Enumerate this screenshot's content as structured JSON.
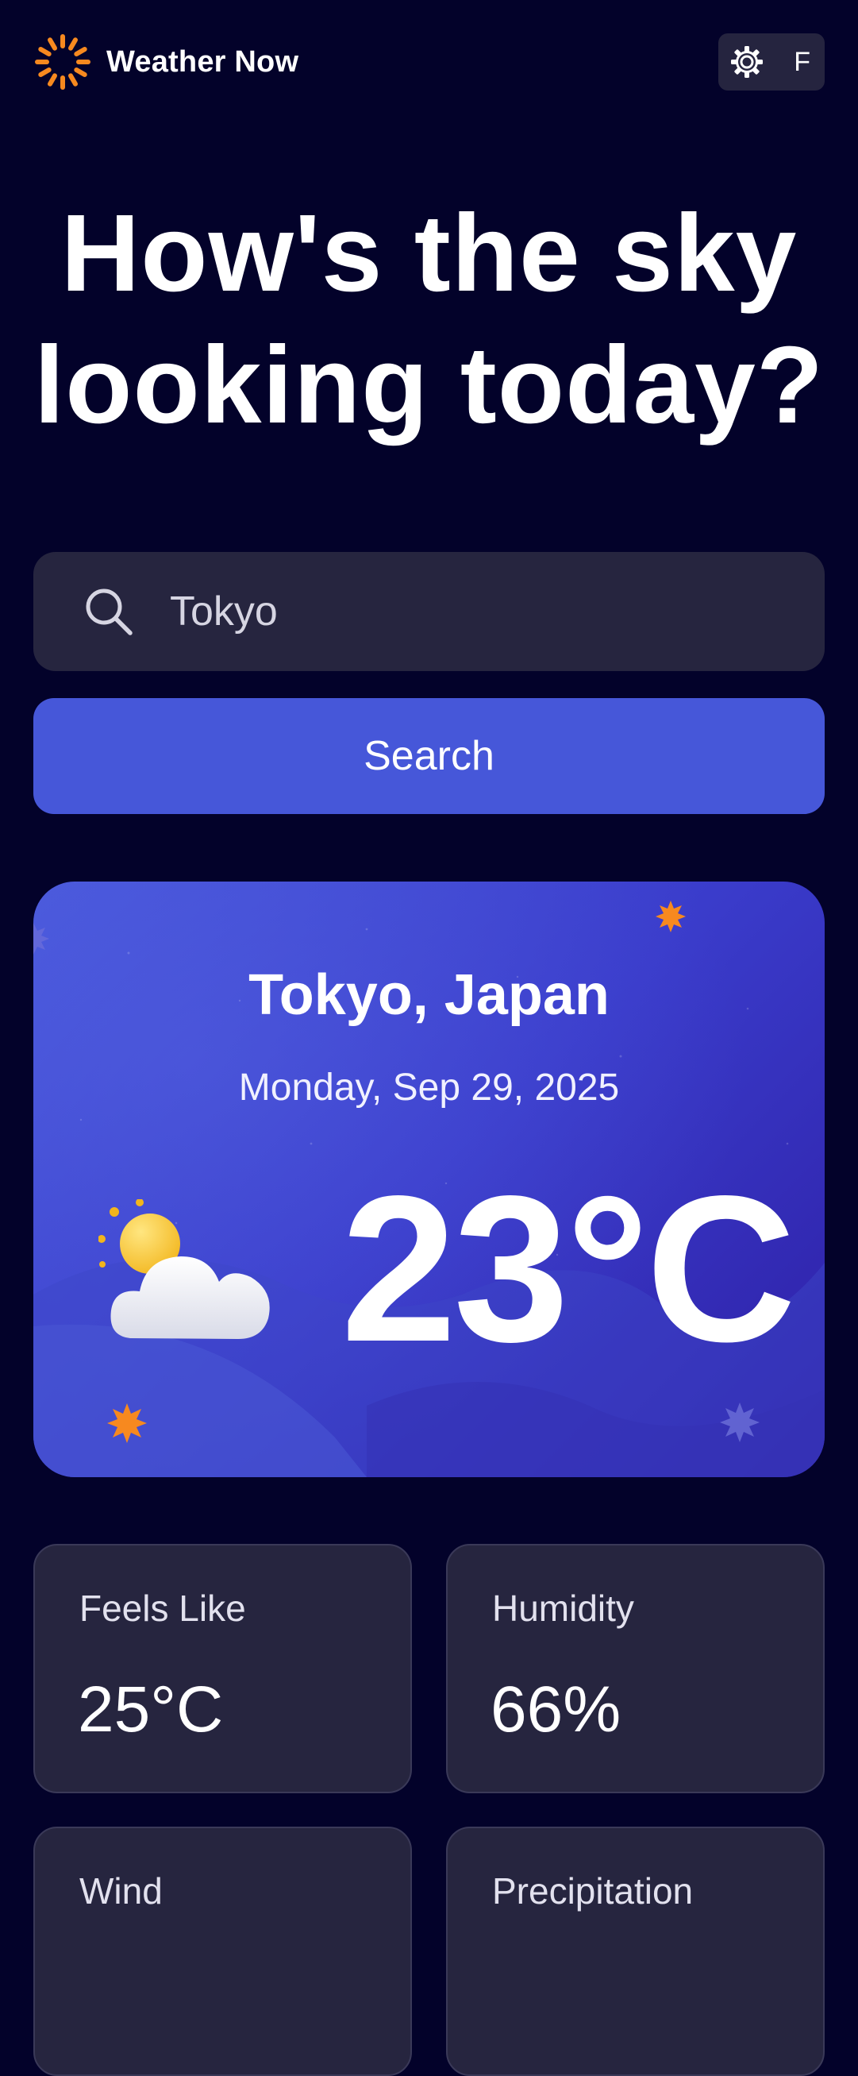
{
  "header": {
    "brand_name": "Weather Now",
    "logo_icon": "sun-icon",
    "settings_icon": "gear-icon",
    "unit_label": "F"
  },
  "hero": {
    "title_line1": "How's the sky",
    "title_line2": "looking today?"
  },
  "search": {
    "icon": "search-icon",
    "value": "Tokyo",
    "button_label": "Search"
  },
  "current": {
    "location": "Tokyo, Japan",
    "date": "Monday, Sep 29, 2025",
    "temperature": "23°C",
    "condition_icon": "partly-cloudy-icon"
  },
  "stats": [
    {
      "label": "Feels Like",
      "value": "25°C"
    },
    {
      "label": "Humidity",
      "value": "66%"
    },
    {
      "label": "Wind",
      "value": ""
    },
    {
      "label": "Precipitation",
      "value": ""
    }
  ],
  "colors": {
    "background": "#03022a",
    "surface": "#26253f",
    "accent": "#4657d9",
    "card_gradient_start": "#4857db",
    "card_gradient_end": "#2e1fa6",
    "sun_orange": "#f7891f"
  }
}
